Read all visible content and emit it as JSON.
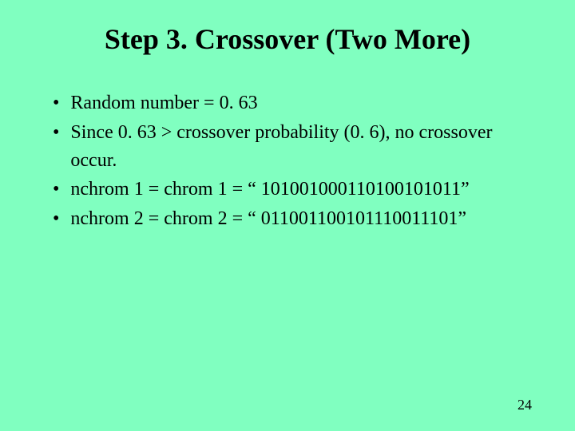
{
  "title": "Step 3. Crossover (Two More)",
  "bullets": [
    "Random number = 0. 63",
    "Since 0. 63 > crossover probability (0. 6), no crossover occur.",
    "nchrom 1 = chrom 1 = “ 101001000110100101011”",
    "nchrom 2 = chrom 2 = “ 011001100101110011101”"
  ],
  "pageNumber": "24"
}
